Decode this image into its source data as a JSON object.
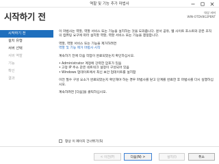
{
  "window": {
    "title": "역할 및 기능 추가 마법사"
  },
  "header": {
    "page_title": "시작하기 전"
  },
  "server": {
    "label": "대상 서버",
    "name": "WIN-OTDV8G2PENT"
  },
  "sidebar": {
    "items": [
      {
        "label": "시작하기 전",
        "state": "active"
      },
      {
        "label": "설치 유형",
        "state": "normal"
      },
      {
        "label": "서버 선택",
        "state": "normal"
      },
      {
        "label": "서버 역할",
        "state": "disabled"
      },
      {
        "label": "기능",
        "state": "disabled"
      },
      {
        "label": "확인",
        "state": "disabled"
      },
      {
        "label": "결과",
        "state": "disabled"
      }
    ]
  },
  "content": {
    "intro": "이 마법사는 역할, 역할 서비스 또는 기능을 설치하는 것을 도와줍니다. 문서 공유, 웹 사이트 호스트와 같은 조직의 컴퓨팅 요구에 따라 설치할 역할, 역할 서비스 또는 기능을 결정합니다.",
    "remove_text": "역할, 역할 서비스 또는 기능을 제거하려면",
    "remove_link": "역할 및 기능 제거 마법사 시작",
    "before_text": "계속하기 전에 다음 작업이 완료되었는지 확인하십시오.",
    "bullets": [
      "Administrator 계정에 강력한 암호가 있음",
      "고정 IP 주소 같은 네트워크 설정이 구성되어 있음",
      "Windows 업데이트에서 최신 보안 업데이트를 설치함"
    ],
    "verify_text": "이전 필수 구성 요소가 완료되었는지 확인해야 하는 경우 마법사를 닫고 단계를 완료한 후 마법사를 다시 실행하십시오.",
    "next_text": "계속하려면 [다음]을 클릭하십시오."
  },
  "skip": {
    "label": "항상 이 페이지 건너뛰기(S)"
  },
  "footer": {
    "prev_label": "< 이전(P)",
    "next_label": "다음(N) >",
    "install_label": "설치(I)",
    "cancel_label": "취소"
  }
}
